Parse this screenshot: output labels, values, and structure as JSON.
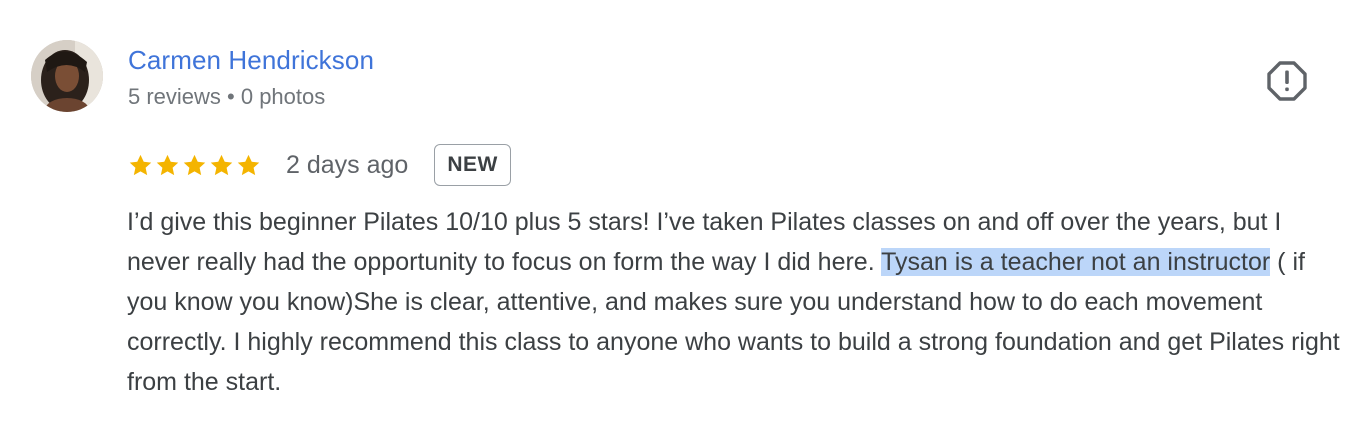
{
  "review": {
    "author": {
      "name": "Carmen Hendrickson",
      "meta": "5 reviews • 0 photos"
    },
    "rating": 5,
    "rating_max": 5,
    "star_color": "#f4b400",
    "time_ago": "2 days ago",
    "badge": "NEW",
    "text_before": "I’d give this beginner Pilates 10/10 plus 5 stars! I’ve taken Pilates classes on and off over the years, but I never really had the opportunity to focus on form the way I did here. ",
    "text_selected": "Tysan is a teacher not an instructor",
    "text_after": " ( if you know you know)She is clear, attentive, and makes sure you understand how to do each movement correctly. I highly recommend this class to anyone who wants to build a strong foundation and get Pilates right from the start.",
    "icons": {
      "report": "report-octagon-icon",
      "star": "star-icon"
    }
  },
  "colors": {
    "author_link": "#3f74d9",
    "selection": "#bcd6f9",
    "meta_text": "#70757a"
  }
}
